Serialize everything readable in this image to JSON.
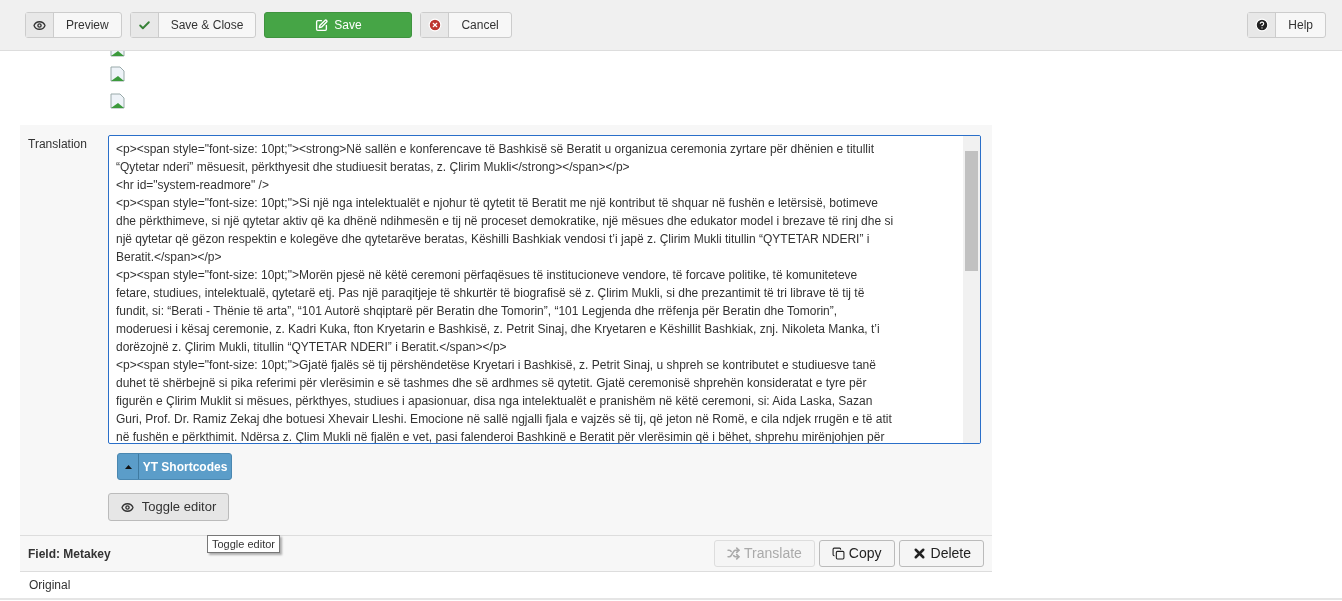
{
  "toolbar": {
    "buttons": [
      {
        "label": "Preview",
        "kind": "preview"
      },
      {
        "label": "Save & Close",
        "kind": "save-close"
      },
      {
        "label": "Save",
        "kind": "save"
      },
      {
        "label": "Cancel",
        "kind": "cancel"
      }
    ],
    "help": {
      "label": "Help"
    }
  },
  "translation": {
    "label": "Translation",
    "lines": [
      "<p><span style=\"font-size: 10pt;\"><strong>Në sallën e konferencave të Bashkisë së Beratit u organizua ceremonia zyrtare për dhënien e titullit",
      "“Qytetar nderi” mësuesit, përkthyesit dhe studiuesit beratas, z. Çlirim Mukli</strong></span></p>",
      "<hr id=\"system-readmore\" />",
      "<p><span style=\"font-size: 10pt;\">Si një nga intelektualët e njohur të qytetit të Beratit me një kontribut të shquar në fushën e letërsisë, botimeve",
      "dhe përkthimeve, si një qytetar aktiv që ka dhënë ndihmesën e tij në proceset demokratike, një mësues dhe edukator model i brezave të rinj dhe si",
      "një qytetar që gëzon respektin e kolegëve dhe qytetarëve beratas, Këshilli Bashkiak vendosi t’i japë z. Çlirim Mukli titullin “QYTETAR NDERI” i",
      "Beratit.</span></p>",
      "<p><span style=\"font-size: 10pt;\">Morën pjesë në këtë ceremoni përfaqësues të institucioneve vendore, të forcave politike, të komuniteteve",
      "fetare, studiues, intelektualë, qytetarë etj. Pas një paraqitjeje të shkurtër të biografisë së z. Çlirim Mukli, si dhe prezantimit të tri librave të tij të",
      "fundit, si: “Berati - Thënie të arta”, “101 Autorë shqiptarë për Beratin dhe Tomorin”, “101 Legjenda dhe rrëfenja për Beratin dhe Tomorin”,",
      "moderuesi i kësaj ceremonie, z. Kadri Kuka, fton Kryetarin e Bashkisë, z. Petrit Sinaj, dhe Kryetaren e Këshillit Bashkiak, znj. Nikoleta Manka, t’i",
      "dorëzojnë z. Çlirim Mukli, titullin “QYTETAR NDERI” i Beratit.</span></p>",
      "<p><span style=\"font-size: 10pt;\">Gjatë fjalës së tij përshëndetëse Kryetari i Bashkisë, z. Petrit Sinaj, u shpreh se kontributet e studiuesve tanë",
      "duhet të shërbejnë si pika referimi për vlerësimin e së tashmes dhe së ardhmes së qytetit. Gjatë ceremonisë shprehën konsideratat e tyre për",
      "figurën e Çlirim Muklit si mësues, përkthyes, studiues i apasionuar, disa nga intelektualët e pranishëm në këtë ceremoni, si: Aida Laska, Sazan",
      "Guri, Prof. Dr. Ramiz Zekaj dhe botuesi Xhevair Lleshi. Emocione në sallë ngjalli fjala e vajzës së tij, që jeton në Romë, e cila ndjek rrugën e të atit",
      "në fushën e përkthimit. Ndërsa z. Çlim Mukli në fjalën e vet, pasi falenderoi Bashkinë e Beratit për vlerësimin që i bëhet, shprehu mirënjohjen për"
    ],
    "shortcodes_button": "YT Shortcodes",
    "toggle_button": "Toggle editor",
    "tooltip": "Toggle editor"
  },
  "field": {
    "title": "Field: Metakey",
    "actions": [
      {
        "label": "Translate",
        "kind": "translate",
        "disabled": true
      },
      {
        "label": "Copy",
        "kind": "copy",
        "disabled": false
      },
      {
        "label": "Delete",
        "kind": "delete",
        "disabled": false
      }
    ]
  },
  "original": {
    "label": "Original"
  }
}
